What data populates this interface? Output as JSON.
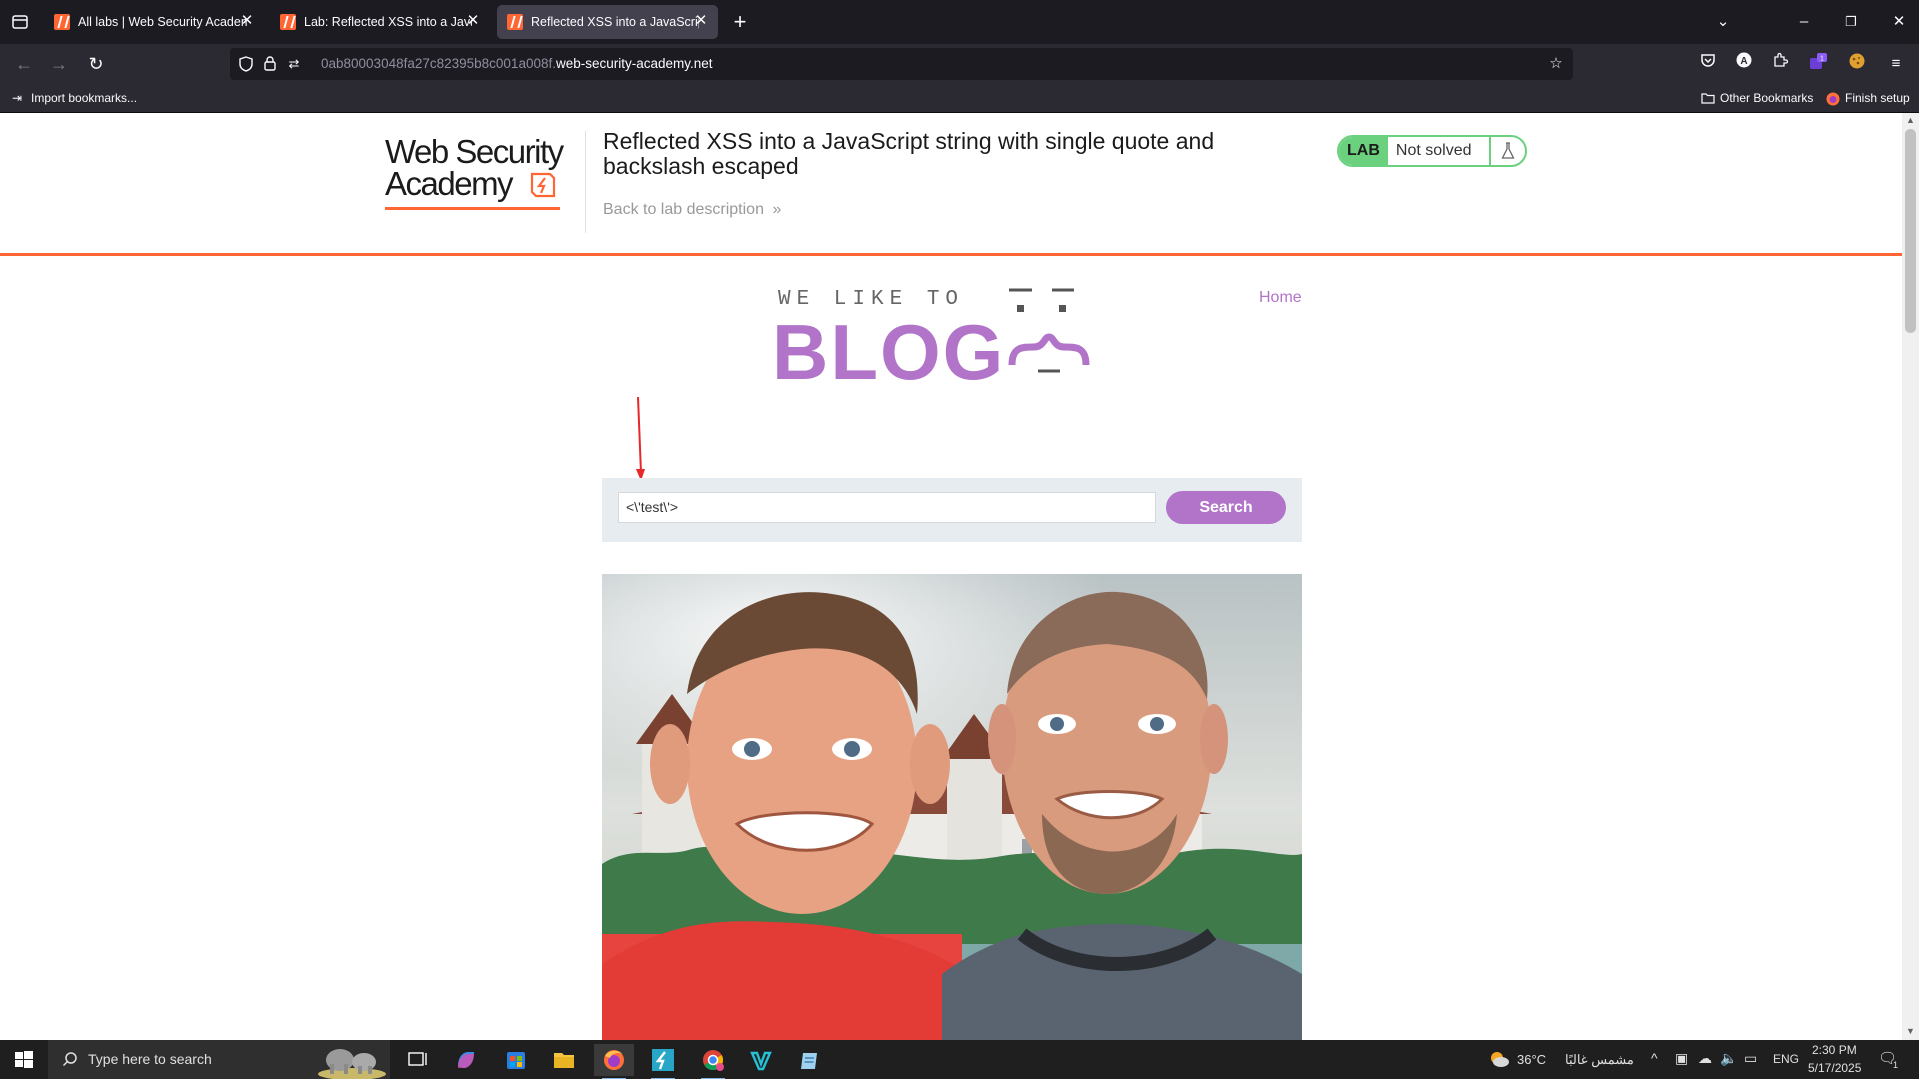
{
  "browser": {
    "tabs": [
      {
        "title": "All labs | Web Security Academy",
        "active": false
      },
      {
        "title": "Lab: Reflected XSS into a JavaSc",
        "active": false
      },
      {
        "title": "Reflected XSS into a JavaScript s",
        "active": true
      }
    ],
    "url": {
      "prefix": "0ab80003048fa27c82395b8c001a008f.",
      "domain": "web-security-academy.net"
    },
    "bookmarks": {
      "import_label": "Import bookmarks...",
      "other_label": "Other Bookmarks",
      "setup_label": "Finish setup"
    },
    "extension_badge": "1"
  },
  "lab_header": {
    "logo_line1": "Web Security",
    "logo_line2": "Academy",
    "title": "Reflected XSS into a JavaScript string with single quote and backslash escaped",
    "back_link": "Back to lab description",
    "status_badge": "LAB",
    "status_text": "Not solved"
  },
  "blog": {
    "home_link": "Home",
    "logo_small": "WE LIKE TO",
    "logo_big": "BLOG"
  },
  "search": {
    "value": "<\\'test\\'>",
    "button_label": "Search"
  },
  "taskbar": {
    "search_placeholder": "Type here to search",
    "weather_temp": "36°C",
    "weather_text": "مشمس غالبًا",
    "language": "ENG",
    "time": "2:30 PM",
    "date": "5/17/2025",
    "notification_count": "1"
  },
  "colors": {
    "accent_orange": "#ff6633",
    "blog_purple": "#b174c9",
    "lab_green": "#6bd17e",
    "annotation_red": "#e8272a"
  }
}
